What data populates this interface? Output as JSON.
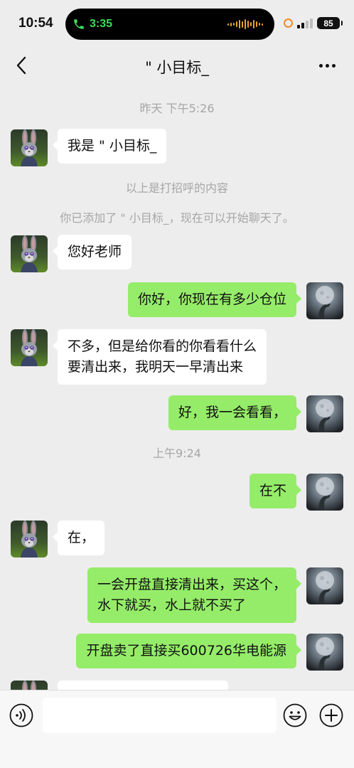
{
  "status_bar": {
    "time": "10:54",
    "call_timer": "3:35",
    "battery": "85"
  },
  "nav": {
    "title": "\" 小目标_"
  },
  "messages": {
    "ts1": "昨天  下午5:26",
    "m1": "我是 \" 小目标_",
    "sys1": "以上是打招呼的内容",
    "sys2": "你已添加了 \" 小目标_，现在可以开始聊天了。",
    "m2": "您好老师",
    "m3": "你好，你现在有多少仓位",
    "m4_line1": "不多，但是给你看的你看看什么",
    "m4_line2": "要清出来，我明天一早清出来",
    "m5": "好，我一会看看，",
    "ts2": "上午9:24",
    "m6": "在不",
    "m7": "在，",
    "m8_line1": "一会开盘直接清出来，买这个，",
    "m8_line2": "水下就买，水上就不买了",
    "m9": "开盘卖了直接买600726华电能源"
  },
  "colors": {
    "background": "#ededed",
    "bubble_self": "#95ec69",
    "bubble_other": "#ffffff",
    "call_green": "#3ddc5a"
  }
}
